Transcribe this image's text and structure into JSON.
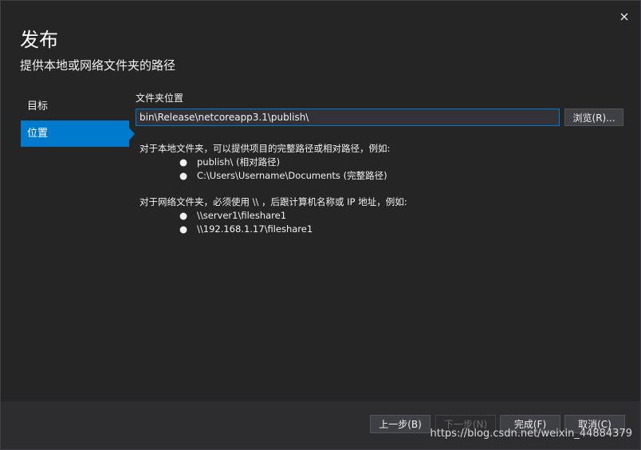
{
  "dialog": {
    "title": "发布",
    "subtitle": "提供本地或网络文件夹的路径"
  },
  "sidebar": {
    "items": [
      {
        "label": "目标"
      },
      {
        "label": "位置"
      }
    ]
  },
  "location": {
    "field_label": "文件夹位置",
    "path_value": "bin\\Release\\netcoreapp3.1\\publish\\",
    "browse_label": "浏览(R)..."
  },
  "help": {
    "local_intro": "对于本地文件夹，可以提供项目的完整路径或相对路径，例如:",
    "local_examples": [
      "publish\\ (相对路径)",
      "C:\\Users\\Username\\Documents (完整路径)"
    ],
    "network_intro": "对于网络文件夹，必须使用 \\\\ ，后跟计算机名称或 IP 地址，例如:",
    "network_examples": [
      "\\\\server1\\fileshare1",
      "\\\\192.168.1.17\\fileshare1"
    ],
    "bullet": "●"
  },
  "footer": {
    "prev_label": "上一步(B)",
    "next_label": "下一步(N)",
    "finish_label": "完成(F)",
    "cancel_label": "取消(C)"
  },
  "watermark": "https://blog.csdn.net/weixin_44884379",
  "colors": {
    "accent": "#007acc",
    "background": "#252526",
    "footer": "#2d2d30"
  },
  "icons": {
    "close": "close-icon"
  }
}
